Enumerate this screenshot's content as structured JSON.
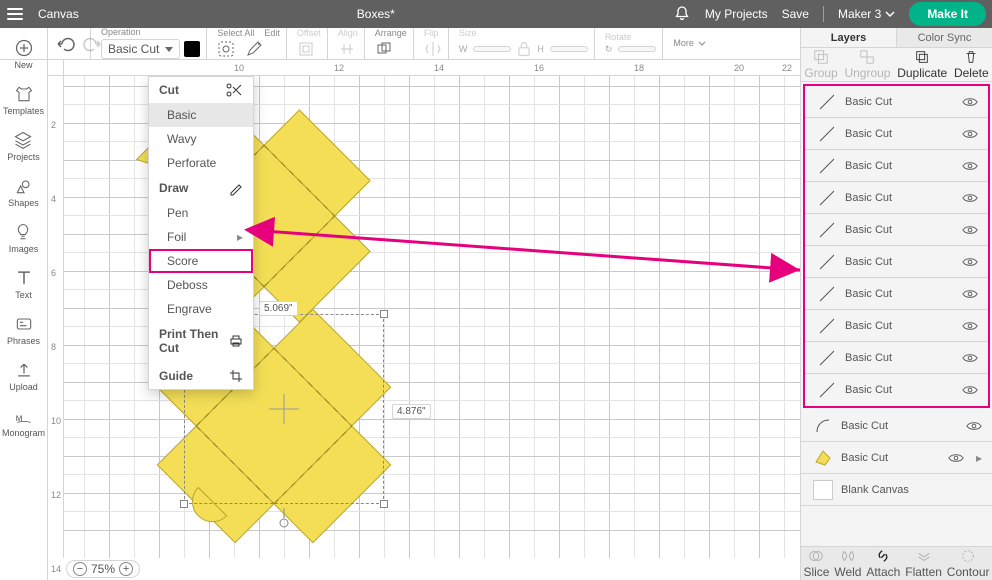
{
  "appbar": {
    "title": "Canvas",
    "document": "Boxes*",
    "my_projects": "My Projects",
    "save": "Save",
    "machine": "Maker 3",
    "make_it": "Make It"
  },
  "toolbar": {
    "operation_label": "Operation",
    "operation_value": "Basic Cut",
    "select_all": "Select All",
    "edit": "Edit",
    "offset": "Offset",
    "align": "Align",
    "arrange": "Arrange",
    "flip": "Flip",
    "size": "Size",
    "rotate": "Rotate",
    "more": "More",
    "w": "W",
    "h": "H",
    "rot_sym": "↻"
  },
  "leftrail": {
    "new": "New",
    "templates": "Templates",
    "projects": "Projects",
    "shapes": "Shapes",
    "images": "Images",
    "text": "Text",
    "phrases": "Phrases",
    "upload": "Upload",
    "monogram": "Monogram"
  },
  "dropdown": {
    "cut": "Cut",
    "basic": "Basic",
    "wavy": "Wavy",
    "perforate": "Perforate",
    "draw": "Draw",
    "pen": "Pen",
    "foil": "Foil",
    "score": "Score",
    "deboss": "Deboss",
    "engrave": "Engrave",
    "ptc": "Print Then Cut",
    "guide": "Guide"
  },
  "canvas": {
    "dim_w": "5.069\"",
    "dim_h": "4.876\"",
    "zoom": "75%",
    "ruler_h": [
      "10",
      "12",
      "14",
      "16",
      "18",
      "20",
      "22"
    ],
    "ruler_v": [
      "2",
      "4",
      "6",
      "8",
      "10",
      "12",
      "14"
    ]
  },
  "rpanel": {
    "layers_tab": "Layers",
    "colorsync_tab": "Color Sync",
    "actions": {
      "group": "Group",
      "ungroup": "Ungroup",
      "duplicate": "Duplicate",
      "delete": "Delete"
    },
    "layers": [
      "Basic Cut",
      "Basic Cut",
      "Basic Cut",
      "Basic Cut",
      "Basic Cut",
      "Basic Cut",
      "Basic Cut",
      "Basic Cut",
      "Basic Cut",
      "Basic Cut",
      "Basic Cut",
      "Basic Cut"
    ],
    "blank": "Blank Canvas",
    "bottom": {
      "slice": "Slice",
      "weld": "Weld",
      "attach": "Attach",
      "flatten": "Flatten",
      "contour": "Contour"
    }
  }
}
